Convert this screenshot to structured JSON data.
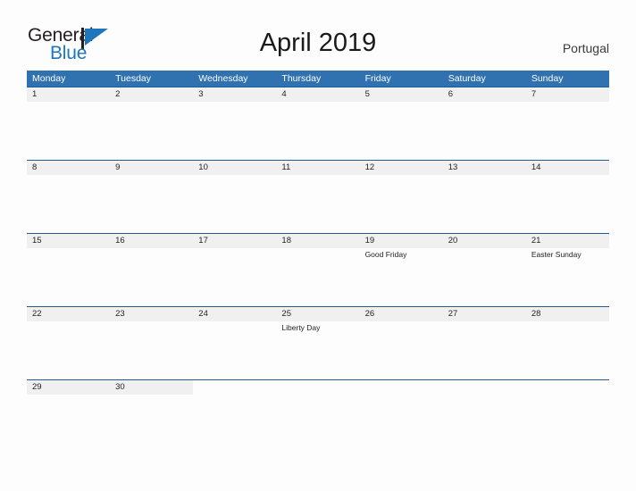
{
  "brand": {
    "name_part1": "General",
    "name_part2": "Blue",
    "flag_icon": "blue-flag-icon",
    "colors": {
      "text_dark": "#231f20",
      "blue": "#1f76bc"
    }
  },
  "header": {
    "title": "April 2019",
    "country": "Portugal"
  },
  "calendar": {
    "colors": {
      "weekday_header_bg": "#3071b0",
      "weekday_header_text": "#ffffff",
      "row_rule": "#1f5c99",
      "day_band_bg": "#f0f0f0",
      "day_text": "#222222"
    },
    "weekdays": [
      "Monday",
      "Tuesday",
      "Wednesday",
      "Thursday",
      "Friday",
      "Saturday",
      "Sunday"
    ],
    "weeks": [
      [
        {
          "day": "1",
          "event": ""
        },
        {
          "day": "2",
          "event": ""
        },
        {
          "day": "3",
          "event": ""
        },
        {
          "day": "4",
          "event": ""
        },
        {
          "day": "5",
          "event": ""
        },
        {
          "day": "6",
          "event": ""
        },
        {
          "day": "7",
          "event": ""
        }
      ],
      [
        {
          "day": "8",
          "event": ""
        },
        {
          "day": "9",
          "event": ""
        },
        {
          "day": "10",
          "event": ""
        },
        {
          "day": "11",
          "event": ""
        },
        {
          "day": "12",
          "event": ""
        },
        {
          "day": "13",
          "event": ""
        },
        {
          "day": "14",
          "event": ""
        }
      ],
      [
        {
          "day": "15",
          "event": ""
        },
        {
          "day": "16",
          "event": ""
        },
        {
          "day": "17",
          "event": ""
        },
        {
          "day": "18",
          "event": ""
        },
        {
          "day": "19",
          "event": "Good Friday"
        },
        {
          "day": "20",
          "event": ""
        },
        {
          "day": "21",
          "event": "Easter Sunday"
        }
      ],
      [
        {
          "day": "22",
          "event": ""
        },
        {
          "day": "23",
          "event": ""
        },
        {
          "day": "24",
          "event": ""
        },
        {
          "day": "25",
          "event": "Liberty Day"
        },
        {
          "day": "26",
          "event": ""
        },
        {
          "day": "27",
          "event": ""
        },
        {
          "day": "28",
          "event": ""
        }
      ],
      [
        {
          "day": "29",
          "event": ""
        },
        {
          "day": "30",
          "event": ""
        },
        {
          "day": "",
          "event": ""
        },
        {
          "day": "",
          "event": ""
        },
        {
          "day": "",
          "event": ""
        },
        {
          "day": "",
          "event": ""
        },
        {
          "day": "",
          "event": ""
        }
      ]
    ]
  }
}
